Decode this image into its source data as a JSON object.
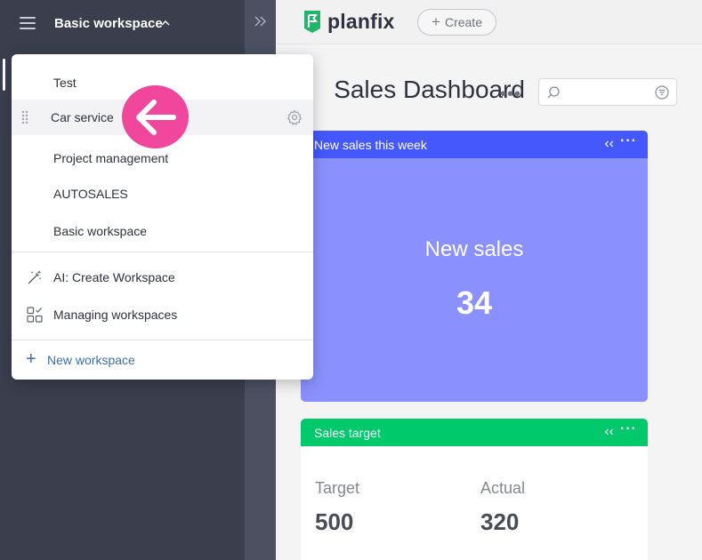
{
  "sidebar": {
    "workspace_title": "Basic workspace"
  },
  "topbar": {
    "logo_text": "planfix",
    "create_label": "Create"
  },
  "page": {
    "title": "Sales Dashboard"
  },
  "widgets": [
    {
      "header": "New sales this week",
      "label": "New sales",
      "value": "34",
      "colors": {
        "header": "#4558fb",
        "body": "#8a91fe"
      }
    },
    {
      "header": "Sales target",
      "colors": {
        "header": "#00c96b",
        "body": "#ffffff"
      },
      "target_label": "Target",
      "target_value": "500",
      "actual_label": "Actual",
      "actual_value": "320"
    }
  ],
  "dropdown": {
    "items": [
      {
        "label": "Test"
      },
      {
        "label": "Car service"
      },
      {
        "label": "Project management"
      },
      {
        "label": "AUTOSALES"
      },
      {
        "label": "Basic workspace"
      }
    ],
    "actions": [
      {
        "label": "AI: Create Workspace",
        "icon": "magic-wand-icon"
      },
      {
        "label": "Managing workspaces",
        "icon": "workspaces-grid-icon"
      }
    ],
    "new_label": "New workspace"
  },
  "colors": {
    "sidebar": "#3b3e4d",
    "accent_link": "#3a6fa8",
    "callout": "#f0479d"
  }
}
